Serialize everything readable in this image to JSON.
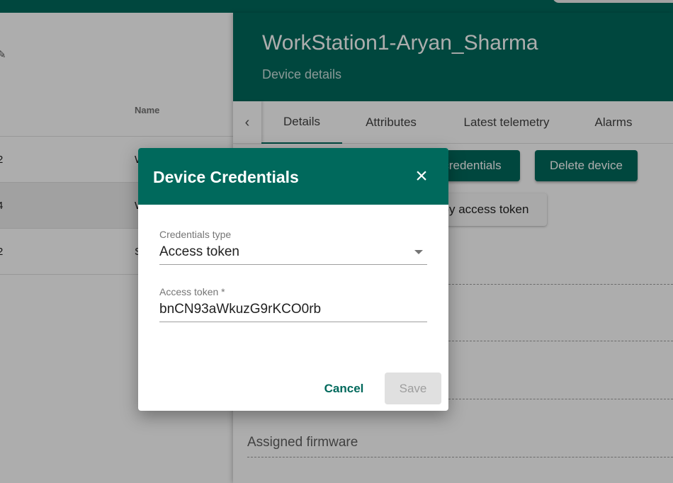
{
  "left_panel": {
    "column_header": "Name",
    "rows": [
      {
        "c1": "2",
        "c2": "W"
      },
      {
        "c1": "4",
        "c2": "W"
      },
      {
        "c1": "2",
        "c2": "S"
      }
    ]
  },
  "detail": {
    "title": "WorkStation1-Aryan_Sharma",
    "subtitle": "Device details",
    "tabs": [
      "Details",
      "Attributes",
      "Latest telemetry",
      "Alarms"
    ],
    "manage_credentials_label": "credentials",
    "delete_device_label": "Delete device",
    "copy_token_label": "py access token",
    "assigned_firmware_label": "Assigned firmware"
  },
  "dialog": {
    "title": "Device Credentials",
    "credentials_type_label": "Credentials type",
    "credentials_type_value": "Access token",
    "access_token_label": "Access token *",
    "access_token_value": "bnCN93aWkuzG9rKCO0rb",
    "cancel_label": "Cancel",
    "save_label": "Save"
  },
  "colors": {
    "primary": "#00695c",
    "overlay": "rgba(0,0,0,0.32)"
  },
  "icons": [
    "edit-icon",
    "chevron-left-icon",
    "close-icon",
    "dropdown-caret-icon"
  ]
}
